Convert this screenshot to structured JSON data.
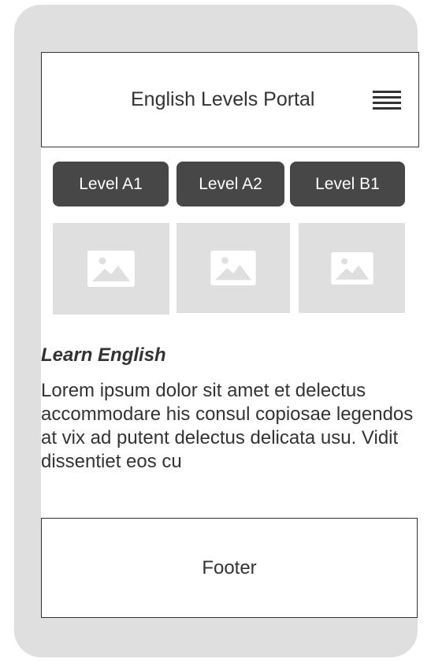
{
  "header": {
    "title": "English Levels Portal",
    "menu_icon": "hamburger-menu-icon"
  },
  "levels": [
    {
      "label": "Level A1"
    },
    {
      "label": "Level A2"
    },
    {
      "label": "Level B1"
    }
  ],
  "thumbnails": [
    {
      "icon": "image-placeholder-icon"
    },
    {
      "icon": "image-placeholder-icon"
    },
    {
      "icon": "image-placeholder-icon"
    }
  ],
  "content": {
    "title": "Learn English",
    "body": "Lorem ipsum dolor sit amet et delectus accommodare his consul copiosae legendos at vix ad putent delectus delicata usu. Vidit dissentiet eos cu"
  },
  "footer": {
    "label": "Footer"
  },
  "colors": {
    "device_frame": "#dfdfdf",
    "button_bg": "#474747",
    "button_text": "#ffffff",
    "text": "#333333",
    "placeholder": "#dfdfdf"
  }
}
